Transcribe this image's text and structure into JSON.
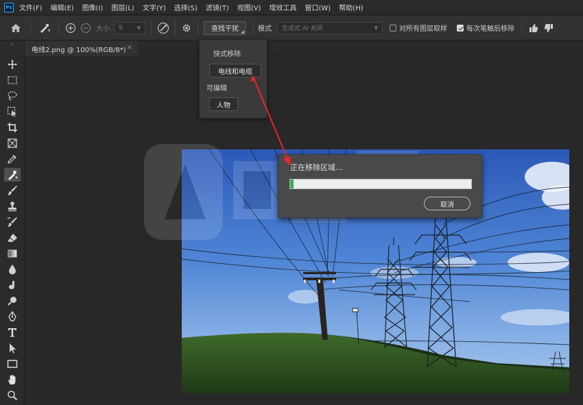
{
  "app": {
    "logo_text": "Ps",
    "menu": [
      "文件(F)",
      "编辑(E)",
      "图像(I)",
      "图层(L)",
      "文字(Y)",
      "选择(S)",
      "滤镜(T)",
      "视图(V)",
      "增效工具",
      "窗口(W)",
      "帮助(H)"
    ]
  },
  "options_bar": {
    "size_label": "大小",
    "size_value": "9",
    "find_distractions_button": "查找干扰",
    "mode_label": "模式",
    "mode_value": "生成式 AI 关闭",
    "sample_all_layers_label": "对所有图层取样",
    "sample_all_layers_checked": false,
    "remove_after_each_stroke_label": "每次笔触后移除",
    "remove_after_each_stroke_checked": true
  },
  "document": {
    "tab_title": "电线2.png @ 100%(RGB/8*)",
    "close_glyph": "×"
  },
  "popup": {
    "heading_primary": "快式移除",
    "button_wires": "电线和电缆",
    "heading_secondary": "可编辑",
    "button_people": "人物"
  },
  "dialog": {
    "title": "正在移除区域...",
    "progress": 0.02,
    "cancel_label": "取消"
  },
  "colors": {
    "accent_arrow": "#e8262b",
    "progress": "#2fb34a",
    "menu_bg": "#2b2b2b",
    "panel_bg": "#323232"
  },
  "toolbar": {
    "grip": "»",
    "tools": [
      "move-icon",
      "marquee-icon",
      "lasso-icon",
      "object-select-icon",
      "crop-icon",
      "frame-icon",
      "eyedropper-icon",
      "remove-tool-icon",
      "brush-icon",
      "stamp-icon",
      "history-brush-icon",
      "eraser-icon",
      "gradient-icon",
      "blur-icon",
      "smudge-icon",
      "dodge-icon",
      "pen-icon",
      "type-icon",
      "path-select-icon",
      "rectangle-icon",
      "hand-icon",
      "zoom-icon"
    ]
  }
}
